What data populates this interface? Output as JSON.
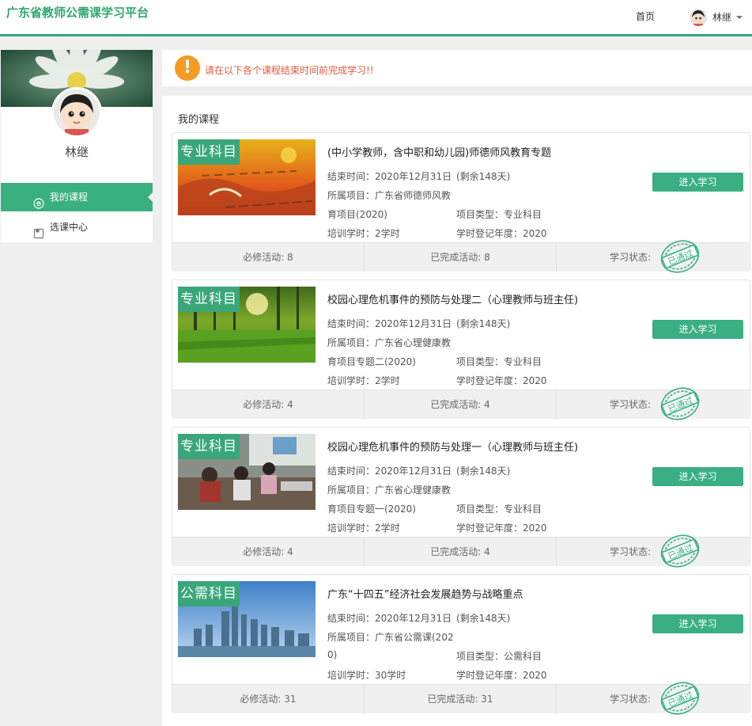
{
  "header": {
    "brand": "广东省教师公需课学习平台",
    "home": "首页",
    "user_name": "林继"
  },
  "sidebar": {
    "profile_name": "林继",
    "menu": [
      {
        "label": "我的课程",
        "active": true,
        "icon": "graduation-icon"
      },
      {
        "label": "选课中心",
        "active": false,
        "icon": "book-icon"
      }
    ]
  },
  "notice": {
    "text": "请在以下各个课程结束时间前完成学习!!"
  },
  "main": {
    "section_title": "我的课程",
    "courses": [
      {
        "tag": "专业科目",
        "title": "(中小学教师，含中职和幼儿园)师德师风教育专题",
        "end_time": "结束时间：2020年12月31日",
        "remaining": "(剩余148天)",
        "project_line1": "所属项目：广东省师德师风教",
        "project_line2": "育项目(2020)",
        "type": "项目类型：专业科目",
        "hours": "培训学时：2学时",
        "year": "学时登记年度：2020",
        "button": "进入学习",
        "required": "必修活动: 8",
        "completed": "已完成活动: 8",
        "status_label": "学习状态:",
        "stamp": "已通过"
      },
      {
        "tag": "专业科目",
        "title": "校园心理危机事件的预防与处理二（心理教师与班主任)",
        "end_time": "结束时间：2020年12月31日",
        "remaining": "(剩余148天)",
        "project_line1": "所属项目：广东省心理健康教",
        "project_line2": "育项目专题二(2020)",
        "type": "项目类型：专业科目",
        "hours": "培训学时：2学时",
        "year": "学时登记年度：2020",
        "button": "进入学习",
        "required": "必修活动: 4",
        "completed": "已完成活动: 4",
        "status_label": "学习状态:",
        "stamp": "已通过"
      },
      {
        "tag": "专业科目",
        "title": "校园心理危机事件的预防与处理一（心理教师与班主任)",
        "end_time": "结束时间：2020年12月31日",
        "remaining": "(剩余148天)",
        "project_line1": "所属项目：广东省心理健康教",
        "project_line2": "育项目专题一(2020)",
        "type": "项目类型：专业科目",
        "hours": "培训学时：2学时",
        "year": "学时登记年度：2020",
        "button": "进入学习",
        "required": "必修活动: 4",
        "completed": "已完成活动: 4",
        "status_label": "学习状态:",
        "stamp": "已通过"
      },
      {
        "tag": "公需科目",
        "title": "广东“十四五”经济社会发展趋势与战略重点",
        "end_time": "结束时间：2020年12月31日",
        "remaining": "(剩余148天)",
        "project_line1": "所属项目：广东省公需课(202",
        "project_line2": "0)",
        "type": "项目类型：公需科目",
        "hours": "培训学时：30学时",
        "year": "学时登记年度：2020",
        "button": "进入学习",
        "required": "必修活动: 31",
        "completed": "已完成活动: 31",
        "status_label": "学习状态:",
        "stamp": "已通过"
      }
    ]
  },
  "colors": {
    "brand_green": "#2fa76f",
    "button_green": "#3aaf84",
    "warning_orange": "#f59a23",
    "notice_red": "#e05b3c"
  }
}
